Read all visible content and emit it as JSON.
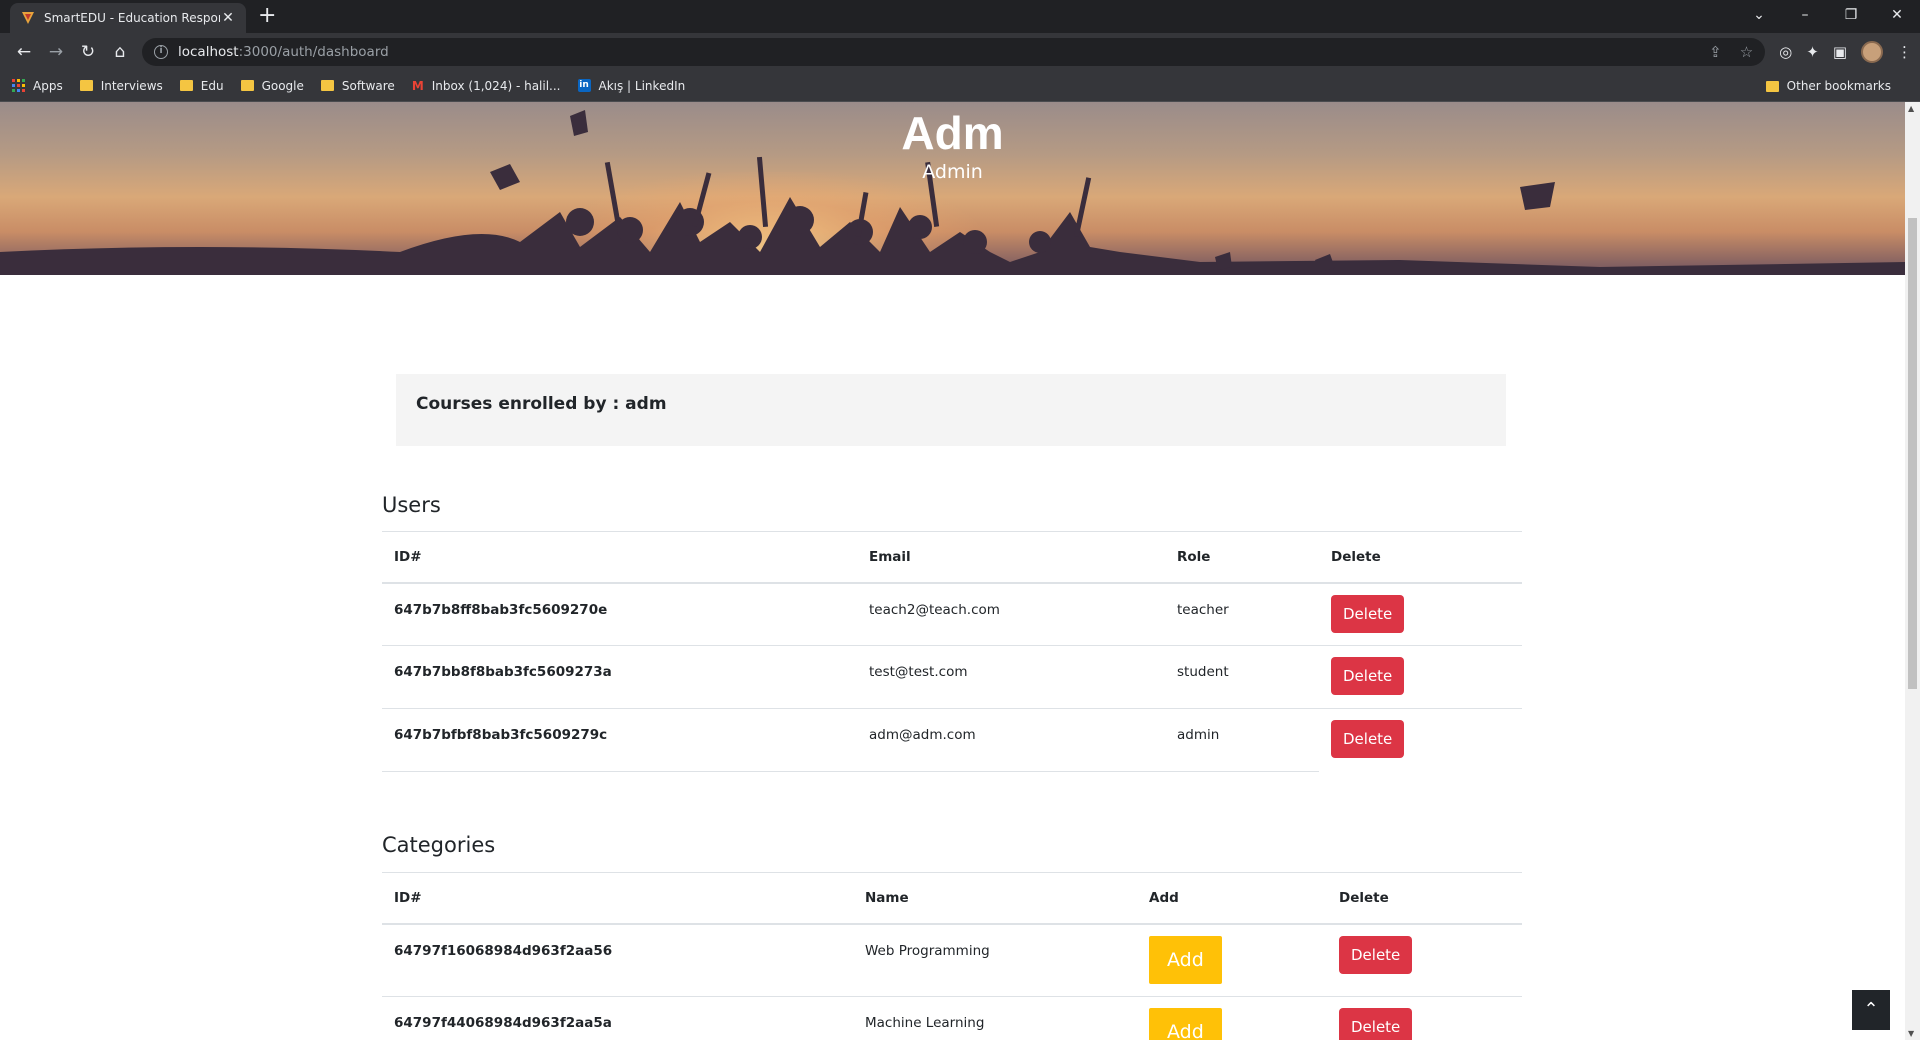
{
  "browser": {
    "tab_title": "SmartEDU - Education Responsiv",
    "url_host": "localhost",
    "url_path": ":3000/auth/dashboard",
    "bookmarks": [
      "Apps",
      "Interviews",
      "Edu",
      "Google",
      "Software",
      "Inbox (1,024) - halil...",
      "Akış | LinkedIn"
    ],
    "other_bookmarks": "Other bookmarks"
  },
  "hero": {
    "title": "Adm",
    "subtitle": "Admin"
  },
  "enrolled": {
    "heading": "Courses enrolled by : adm"
  },
  "users": {
    "title": "Users",
    "headers": [
      "ID#",
      "Email",
      "Role",
      "Delete"
    ],
    "rows": [
      {
        "id": "647b7b8ff8bab3fc5609270e",
        "email": "teach2@teach.com",
        "role": "teacher",
        "delete": "Delete"
      },
      {
        "id": "647b7bb8f8bab3fc5609273a",
        "email": "test@test.com",
        "role": "student",
        "delete": "Delete"
      },
      {
        "id": "647b7bfbf8bab3fc5609279c",
        "email": "adm@adm.com",
        "role": "admin",
        "delete": "Delete"
      }
    ]
  },
  "categories": {
    "title": "Categories",
    "headers": [
      "ID#",
      "Name",
      "Add",
      "Delete"
    ],
    "rows": [
      {
        "id": "64797f16068984d963f2aa56",
        "name": "Web Programming",
        "add": "Add",
        "delete": "Delete"
      },
      {
        "id": "64797f44068984d963f2aa5a",
        "name": "Machine Learning",
        "add": "Add",
        "delete": "Delete"
      }
    ]
  },
  "icons": {
    "back": "back-arrow-icon",
    "forward": "forward-arrow-icon",
    "reload": "reload-icon",
    "home": "home-icon",
    "scroll_top": "chevron-up-icon"
  },
  "colors": {
    "delete": "#dc3545",
    "add": "#ffc107",
    "chrome_dark": "#202124"
  }
}
